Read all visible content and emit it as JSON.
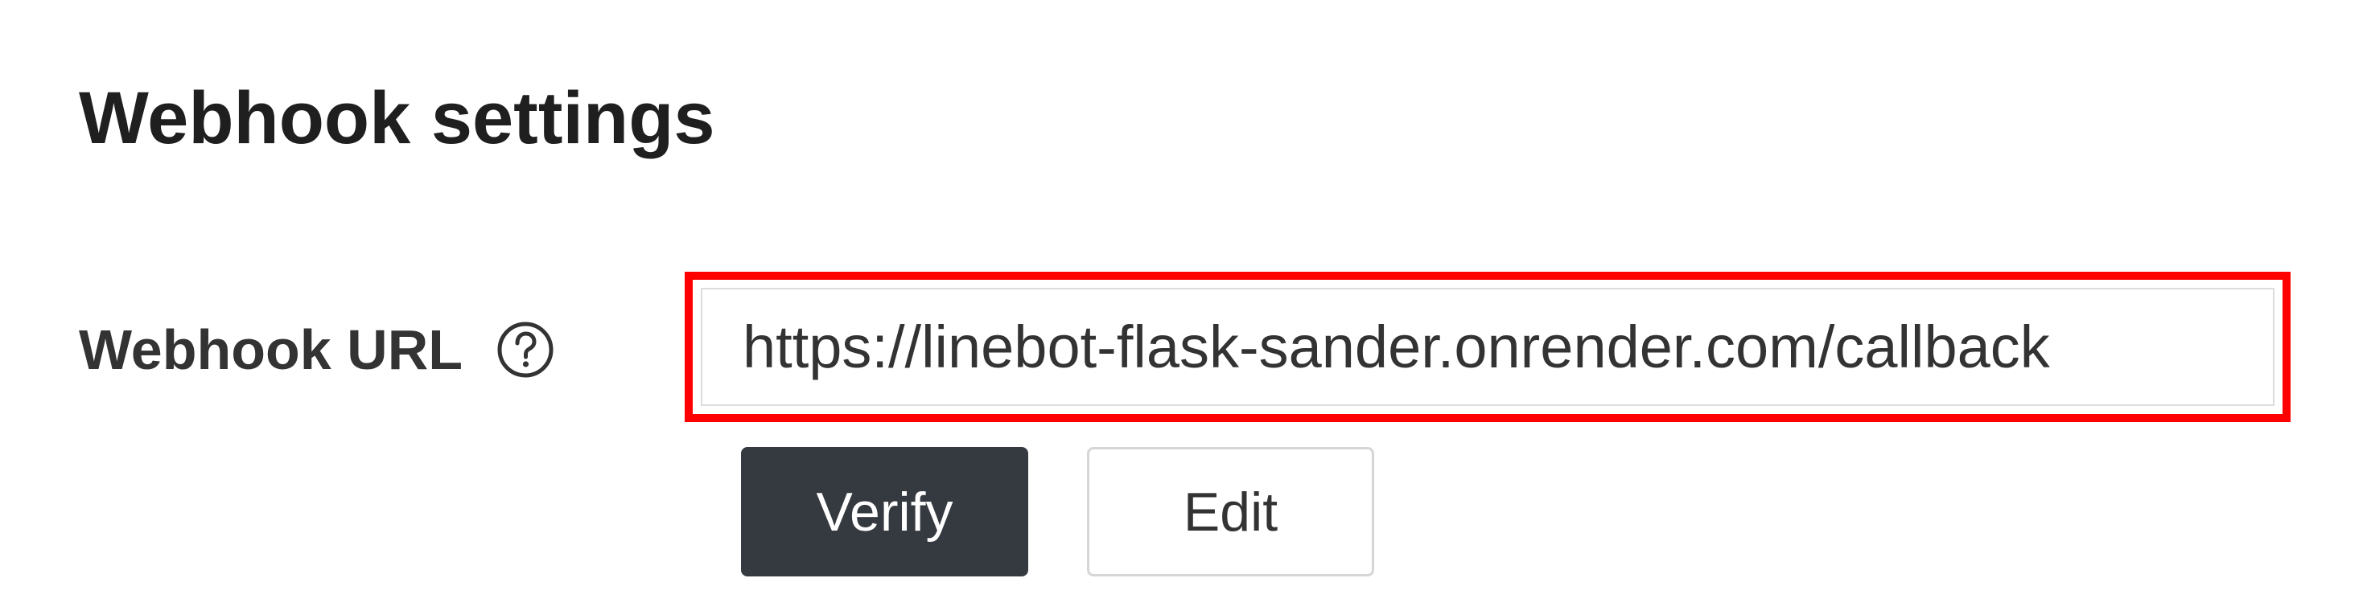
{
  "section": {
    "title": "Webhook settings"
  },
  "webhook_url": {
    "label": "Webhook URL",
    "help_icon": "question-circle-icon",
    "value": "https://linebot-flask-sander.onrender.com/callback"
  },
  "actions": {
    "verify_label": "Verify",
    "edit_label": "Edit"
  },
  "colors": {
    "highlight": "#ff0000",
    "verify_bg": "#343a40",
    "edit_border": "#d6d6d6",
    "text": "#333333"
  }
}
